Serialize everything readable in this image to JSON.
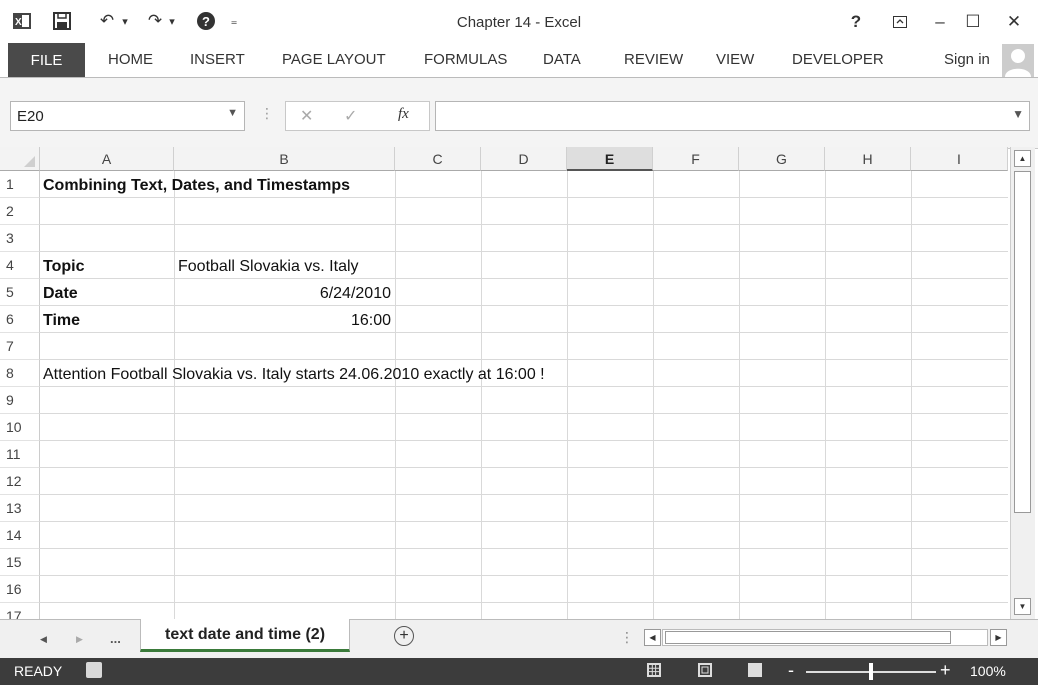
{
  "window": {
    "title": "Chapter 14 - Excel",
    "help": "?",
    "minimize": "–",
    "maximize": "☐",
    "close": "✕",
    "quick_access": {
      "undo": "↶",
      "redo": "↷",
      "dropdown": "▾",
      "customize": "₌"
    }
  },
  "ribbon": {
    "tabs": [
      "FILE",
      "HOME",
      "INSERT",
      "PAGE LAYOUT",
      "FORMULAS",
      "DATA",
      "REVIEW",
      "VIEW",
      "DEVELOPER"
    ],
    "sign_in": "Sign in"
  },
  "formula_bar": {
    "name_box": "E20",
    "cancel_symbol": "✕",
    "enter_symbol": "✓",
    "fx_symbol": "fx",
    "value": ""
  },
  "grid": {
    "columns": [
      "A",
      "B",
      "C",
      "D",
      "E",
      "F",
      "G",
      "H",
      "I"
    ],
    "selected_column": "E",
    "rows": [
      "1",
      "2",
      "3",
      "4",
      "5",
      "6",
      "7",
      "8",
      "9",
      "10",
      "11",
      "12",
      "13",
      "14",
      "15",
      "16",
      "17"
    ],
    "cells": {
      "A1": "Combining Text, Dates, and Timestamps",
      "A4": "Topic",
      "B4": "Football Slovakia vs. Italy",
      "A5": "Date",
      "B5": "6/24/2010",
      "A6": "Time",
      "B6": "16:00",
      "A8": "Attention Football Slovakia vs. Italy starts 24.06.2010 exactly at 16:00 !"
    }
  },
  "sheet_tabs": {
    "nav_prev": "◀",
    "nav_next": "▶",
    "more": "...",
    "active": "text date and time (2)",
    "add": "+"
  },
  "status_bar": {
    "status": "READY",
    "zoom": "100%",
    "zoom_minus": "-",
    "zoom_plus": "+"
  }
}
